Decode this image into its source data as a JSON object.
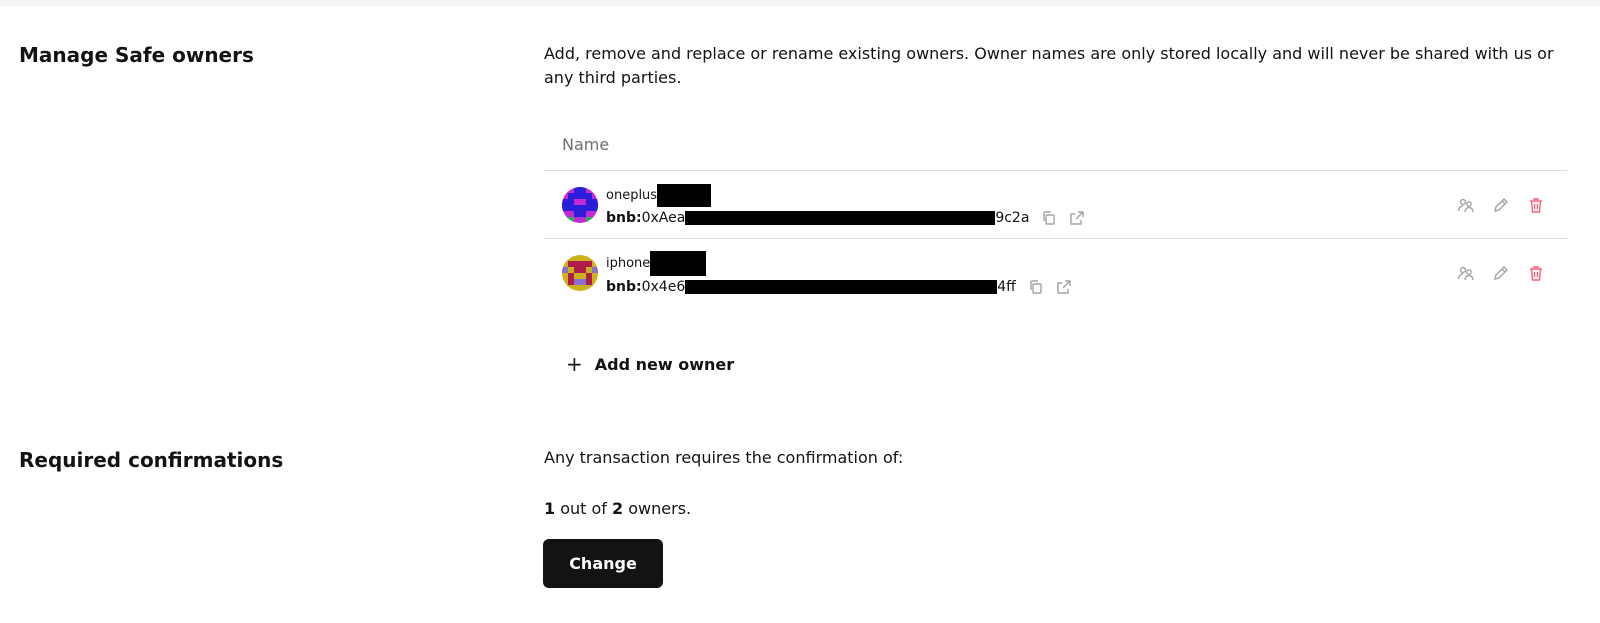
{
  "manage": {
    "title": "Manage Safe owners",
    "description": "Add, remove and replace or rename existing owners. Owner names are only stored locally and will never be shared with us or any third parties.",
    "table_header": "Name",
    "owners": [
      {
        "name": "oneplus",
        "network_prefix": "bnb:",
        "addr_start": "0xAea",
        "addr_end": "9c2a",
        "colors": {
          "bg": "#c32ad6",
          "fg": "#2a1ed8",
          "accent": "#2fae5a"
        }
      },
      {
        "name": "iphone",
        "network_prefix": "bnb:",
        "addr_start": "0x4e6",
        "addr_end": "4ff",
        "colors": {
          "bg": "#c9b21a",
          "fg": "#b01d4b",
          "accent": "#8a6ed0"
        }
      }
    ],
    "add_owner_label": "Add new owner"
  },
  "confirmations": {
    "title": "Required confirmations",
    "description": "Any transaction requires the confirmation of:",
    "required": "1",
    "out_of_text": " out of ",
    "total": "2",
    "owners_suffix": " owners.",
    "change_label": "Change"
  },
  "icons": {
    "copy": "copy-icon",
    "open": "external-link-icon",
    "replace": "replace-owner-icon",
    "edit": "edit-icon",
    "delete": "trash-icon"
  },
  "colors": {
    "danger": "#ff5f72",
    "icon_gray": "#a1a3a7",
    "button_bg": "#121312"
  }
}
